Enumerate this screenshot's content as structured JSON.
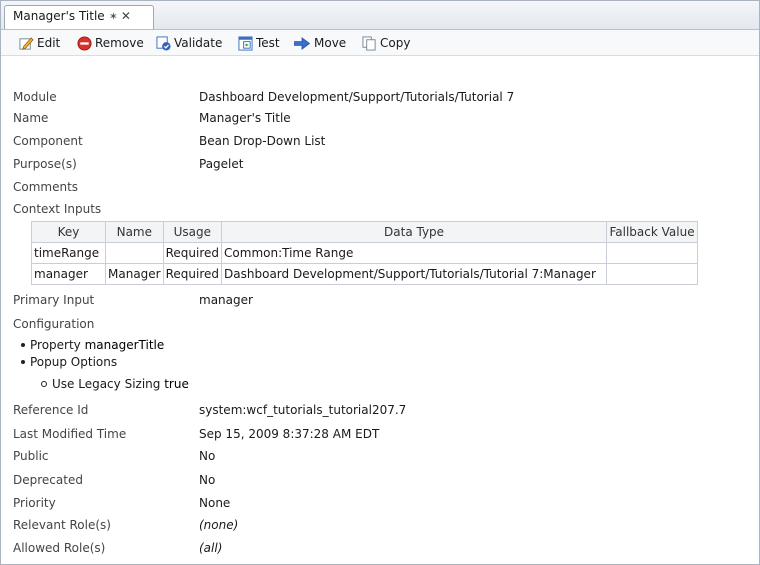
{
  "tab": {
    "title": "Manager's Title",
    "pin_glyph": "✶",
    "close_glyph": "✕"
  },
  "toolbar": {
    "edit": "Edit",
    "remove": "Remove",
    "validate": "Validate",
    "test": "Test",
    "move": "Move",
    "copy": "Copy"
  },
  "props": {
    "module": {
      "label": "Module",
      "value": "Dashboard Development/Support/Tutorials/Tutorial 7"
    },
    "name": {
      "label": "Name",
      "value": "Manager's Title"
    },
    "component": {
      "label": "Component",
      "value": "Bean Drop-Down List"
    },
    "purpose": {
      "label": "Purpose(s)",
      "value": "Pagelet"
    },
    "comments": {
      "label": "Comments"
    },
    "context_inputs": {
      "label": "Context Inputs"
    },
    "primary_input": {
      "label": "Primary Input",
      "value": "manager"
    },
    "configuration": {
      "label": "Configuration"
    },
    "reference_id": {
      "label": "Reference Id",
      "value": "system:wcf_tutorials_tutorial207.7"
    },
    "last_modified": {
      "label": "Last Modified Time",
      "value": "Sep 15, 2009 8:37:28 AM EDT"
    },
    "public": {
      "label": "Public",
      "value": "No"
    },
    "deprecated": {
      "label": "Deprecated",
      "value": "No"
    },
    "priority": {
      "label": "Priority",
      "value": "None"
    },
    "relevant_roles": {
      "label": "Relevant Role(s)",
      "value": "(none)"
    },
    "allowed_roles": {
      "label": "Allowed Role(s)",
      "value": "(all)"
    }
  },
  "context_table": {
    "headers": [
      "Key",
      "Name",
      "Usage",
      "Data Type",
      "Fallback Value"
    ],
    "rows": [
      [
        "timeRange",
        "",
        "Required",
        "Common:Time Range",
        ""
      ],
      [
        "manager",
        "Manager",
        "Required",
        "Dashboard Development/Support/Tutorials/Tutorial 7:Manager",
        ""
      ]
    ]
  },
  "config": {
    "property_label": "Property",
    "property_value": "managerTitle",
    "popup_label": "Popup Options",
    "legacy_label": "Use Legacy Sizing",
    "legacy_value": "true"
  },
  "icons": [
    "pin-icon",
    "close-icon",
    "edit-icon",
    "remove-icon",
    "validate-icon",
    "test-icon",
    "move-icon",
    "copy-icon"
  ],
  "colors": {
    "remove_red": "#d9322b",
    "link_blue": "#2d63b8",
    "border": "#a9b3c2"
  }
}
